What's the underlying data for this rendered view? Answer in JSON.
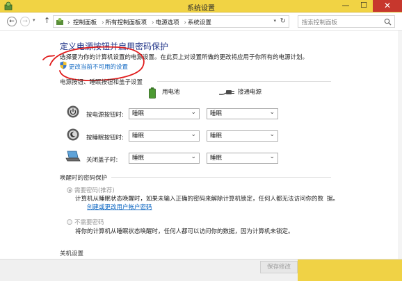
{
  "window": {
    "title": "系统设置",
    "min_glyph": "—",
    "max_glyph": "☐",
    "close_glyph": "✕"
  },
  "nav": {
    "back_glyph": "←",
    "forward_glyph": "→",
    "dropdown_glyph": "▾",
    "up_glyph": "↑",
    "breadcrumbs": [
      "控制面板",
      "所有控制面板项",
      "电源选项",
      "系统设置"
    ],
    "separator": "›",
    "refresh_glyph": "↻"
  },
  "search": {
    "placeholder": "搜索控制面板"
  },
  "page": {
    "title": "定义电源按钮并启用密码保护",
    "description": "选择要为你的计算机设置的电源设置。在此页上对设置所做的更改将应用于你所有的电源计划。",
    "change_link": "更改当前不可用的设置",
    "annotation_color": "#e01b1b"
  },
  "buttons_section": {
    "heading": "电源按钮、睡眠按钮和盖子设置",
    "battery_label": "用电池",
    "plugged_label": "接通电源",
    "rows": [
      {
        "label": "按电源按钮时:",
        "battery": "睡眠",
        "plugged": "睡眠"
      },
      {
        "label": "按睡眠按钮时:",
        "battery": "睡眠",
        "plugged": "睡眠"
      },
      {
        "label": "关闭盖子时:",
        "battery": "睡眠",
        "plugged": "睡眠"
      }
    ]
  },
  "password_section": {
    "heading": "唤醒时的密码保护",
    "require_label": "需要密码(推荐)",
    "require_desc": "计算机从睡眠状态唤醒时，如果未输入正确的密码来解除计算机锁定，任何人都无法访问你的数",
    "require_desc2": "据。",
    "account_link": "创建或更改用户帐户密码",
    "no_password_label": "不需要密码",
    "no_password_desc": "将你的计算机从睡眠状态唤醒时，任何人都可以访问你的数据，因为计算机未锁定。"
  },
  "shutdown_section": {
    "heading": "关机设置"
  },
  "footer": {
    "save_label": "保存修改"
  }
}
